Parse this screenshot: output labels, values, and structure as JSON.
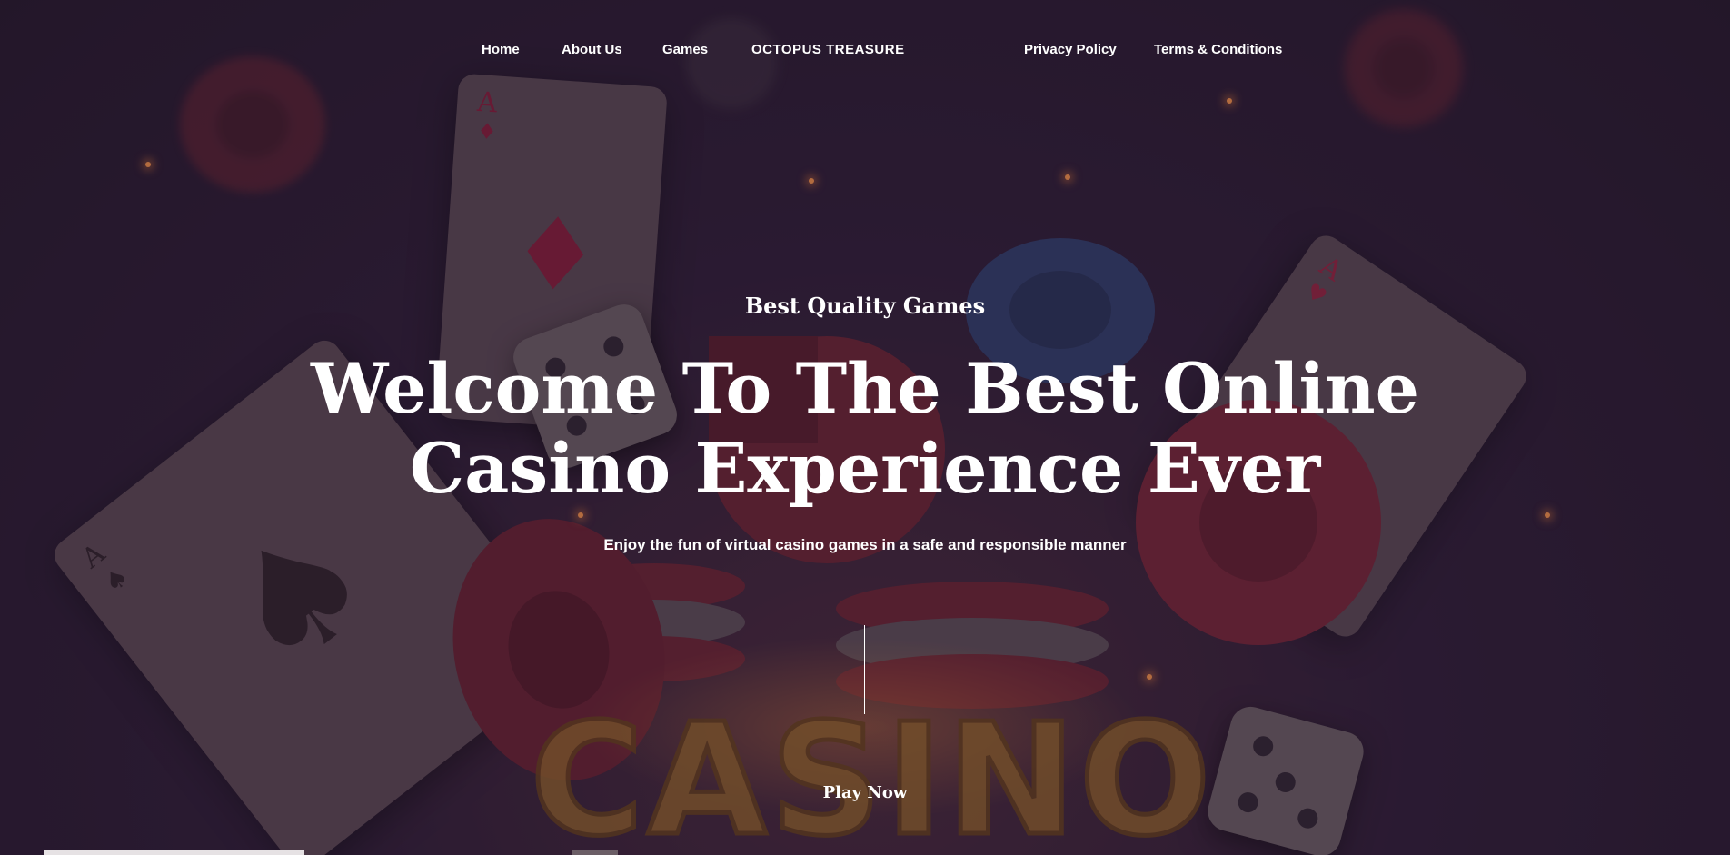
{
  "nav": {
    "items": [
      {
        "label": "Home"
      },
      {
        "label": "About Us"
      },
      {
        "label": "Games"
      },
      {
        "label": "Privacy Policy"
      },
      {
        "label": "Terms & Conditions"
      }
    ],
    "logo_text": "OCTOPUS TREASURE"
  },
  "hero": {
    "eyebrow": "Best Quality Games",
    "headline_line1": "Welcome To The Best Online",
    "headline_line2": "Casino Experience Ever",
    "subline": "Enjoy the fun of virtual casino games in a safe and responsible manner",
    "cta_label": "Play Now",
    "background_word": "CASINO",
    "card_ranks": {
      "diamond_card": "A",
      "spade_card": "A",
      "heart_card": "A"
    }
  },
  "colors": {
    "background": "#24182c",
    "text": "#ffffff",
    "card": "#5b4a54",
    "chip_red": "#8a2a36",
    "chip_blue": "#2f3f6e",
    "casino_gold": "#9a6a2a"
  },
  "icons": [
    "diamond-suit-icon",
    "spade-suit-icon",
    "heart-suit-icon",
    "dice-icon",
    "casino-chip-icon"
  ]
}
